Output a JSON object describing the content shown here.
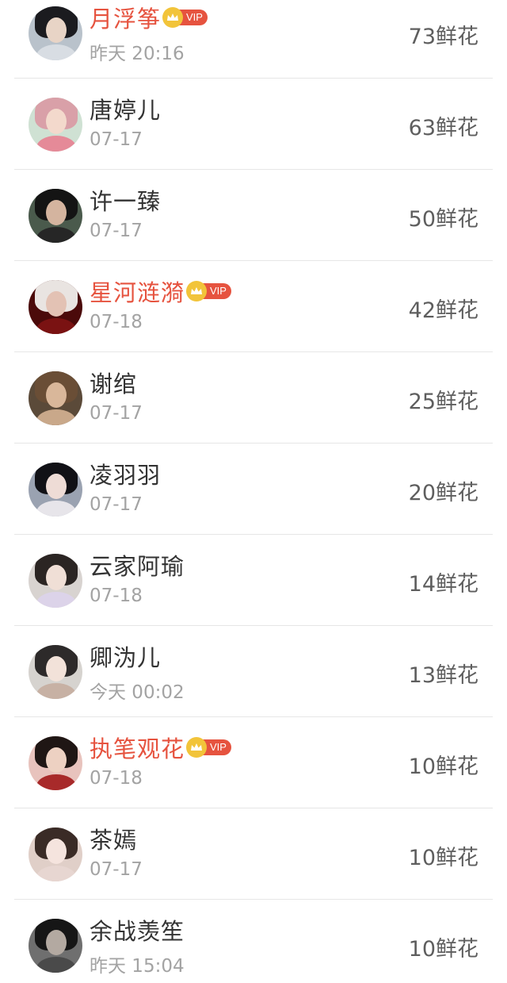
{
  "vip_badge_label": "VIP",
  "unit": "鲜花",
  "colors": {
    "vip_name": "#e6533f",
    "normal_name": "#333333",
    "time": "#a3a3a3",
    "flowers": "#5e5e5e",
    "vip_badge": "#e6533f",
    "crown": "#f2c43a"
  },
  "rows": [
    {
      "name": "月浮筝",
      "vip": true,
      "time": "昨天 20:16",
      "flowers": "73鲜花",
      "avatar": {
        "hair": "#1b1b1f",
        "face": "#e8d4c6",
        "body": "#d8dde3",
        "bg": "#b9c2cb"
      }
    },
    {
      "name": "唐婷儿",
      "vip": false,
      "time": "07-17",
      "flowers": "63鲜花",
      "avatar": {
        "hair": "#d9a0a8",
        "face": "#f3d9cc",
        "body": "#e58a98",
        "bg": "#cfe1d3"
      }
    },
    {
      "name": "许一臻",
      "vip": false,
      "time": "07-17",
      "flowers": "50鲜花",
      "avatar": {
        "hair": "#141414",
        "face": "#d4b49f",
        "body": "#262626",
        "bg": "#4a5a4c"
      }
    },
    {
      "name": "星河涟漪",
      "vip": true,
      "time": "07-18",
      "flowers": "42鲜花",
      "avatar": {
        "hair": "#e9e4e1",
        "face": "#e3c2b4",
        "body": "#7a1212",
        "bg": "#4b0a0a"
      }
    },
    {
      "name": "谢绾",
      "vip": false,
      "time": "07-17",
      "flowers": "25鲜花",
      "avatar": {
        "hair": "#6a4e36",
        "face": "#d9b79a",
        "body": "#c9a88a",
        "bg": "#5b4a39"
      }
    },
    {
      "name": "凌羽羽",
      "vip": false,
      "time": "07-17",
      "flowers": "20鲜花",
      "avatar": {
        "hair": "#111116",
        "face": "#eedcd6",
        "body": "#e7e5ea",
        "bg": "#9aa2b1"
      }
    },
    {
      "name": "云家阿瑜",
      "vip": false,
      "time": "07-18",
      "flowers": "14鲜花",
      "avatar": {
        "hair": "#2b2523",
        "face": "#f0dfd6",
        "body": "#dcd3e9",
        "bg": "#d8d3d0"
      }
    },
    {
      "name": "卿沩儿",
      "vip": false,
      "time": "今天 00:02",
      "flowers": "13鲜花",
      "avatar": {
        "hair": "#2d2a2a",
        "face": "#f2e2d9",
        "body": "#c7b1a4",
        "bg": "#d6d3cf"
      }
    },
    {
      "name": "执笔观花",
      "vip": true,
      "time": "07-18",
      "flowers": "10鲜花",
      "avatar": {
        "hair": "#1f1614",
        "face": "#edd1c2",
        "body": "#a82a2a",
        "bg": "#e8c3bd"
      }
    },
    {
      "name": "茶嫣",
      "vip": false,
      "time": "07-17",
      "flowers": "10鲜花",
      "avatar": {
        "hair": "#3a2b26",
        "face": "#f5e4de",
        "body": "#e7d6d1",
        "bg": "#e0cfc8"
      }
    },
    {
      "name": "余战羡笙",
      "vip": false,
      "time": "昨天 15:04",
      "flowers": "10鲜花",
      "avatar": {
        "hair": "#161616",
        "face": "#b3a9a1",
        "body": "#4a4a4a",
        "bg": "#6f6f6f"
      }
    }
  ]
}
